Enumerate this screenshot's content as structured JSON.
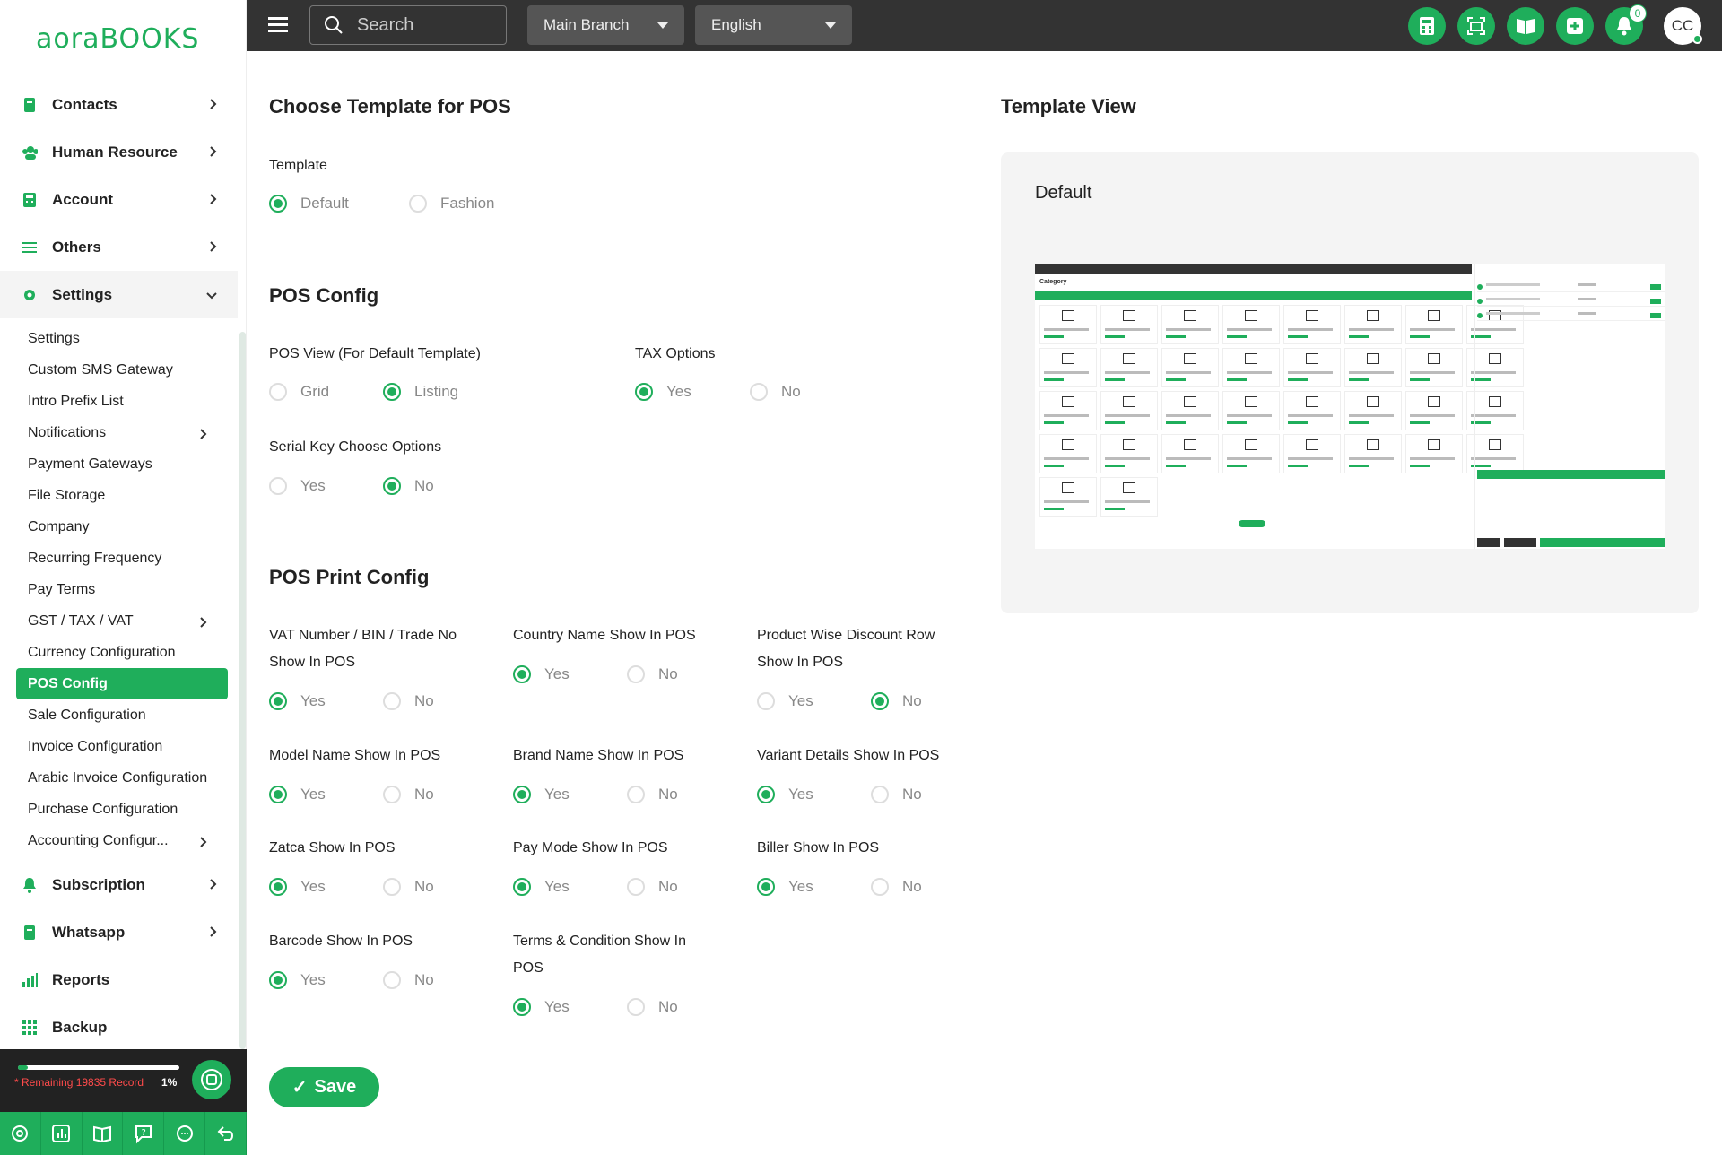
{
  "brand": {
    "logo_a": "aora",
    "logo_b": "BOOKS"
  },
  "sidebar": {
    "main": [
      {
        "label": "Contacts",
        "icon": "contacts-icon"
      },
      {
        "label": "Human Resource",
        "icon": "users-icon"
      },
      {
        "label": "Account",
        "icon": "calculator-icon"
      },
      {
        "label": "Others",
        "icon": "menu-icon"
      },
      {
        "label": "Settings",
        "icon": "gear-icon"
      }
    ],
    "sub": [
      {
        "label": "Settings"
      },
      {
        "label": "Custom SMS Gateway"
      },
      {
        "label": "Intro Prefix List"
      },
      {
        "label": "Notifications",
        "has_children": true
      },
      {
        "label": "Payment Gateways"
      },
      {
        "label": "File Storage"
      },
      {
        "label": "Company"
      },
      {
        "label": "Recurring Frequency"
      },
      {
        "label": "Pay Terms"
      },
      {
        "label": "GST / TAX / VAT",
        "has_children": true
      },
      {
        "label": "Currency Configuration"
      },
      {
        "label": "POS Config",
        "active": true
      },
      {
        "label": "Sale Configuration"
      },
      {
        "label": "Invoice Configuration"
      },
      {
        "label": "Arabic Invoice Configuration"
      },
      {
        "label": "Purchase Configuration"
      },
      {
        "label": "Accounting Configur...",
        "has_children": true
      }
    ],
    "bottom": [
      {
        "label": "Subscription",
        "icon": "bell-icon"
      },
      {
        "label": "Whatsapp",
        "icon": "whatsapp-icon"
      },
      {
        "label": "Reports",
        "icon": "bar-chart-icon"
      },
      {
        "label": "Backup",
        "icon": "grid-icon"
      }
    ],
    "footer": {
      "remaining": "* Remaining 19835 Record",
      "percent": "1%",
      "progress_fraction": 0.01
    }
  },
  "topbar": {
    "search_placeholder": "Search",
    "branch": "Main Branch",
    "language": "English",
    "notification_count": "0",
    "avatar": "CC"
  },
  "form": {
    "title": "Choose Template for POS",
    "template_label": "Template",
    "template_options": [
      "Default",
      "Fashion"
    ],
    "pos_config_title": "POS Config",
    "pos_view_label": "POS View (For Default Template)",
    "pos_view_options": [
      "Grid",
      "Listing"
    ],
    "tax_label": "TAX Options",
    "serial_label": "Serial Key Choose Options",
    "yes": "Yes",
    "no": "No",
    "print_title": "POS Print Config",
    "vat_label": "VAT Number / BIN / Trade No Show In POS",
    "country_label": "Country Name Show In POS",
    "discount_label": "Product Wise Discount Row Show In POS",
    "model_label": "Model Name Show In POS",
    "brand_label": "Brand Name Show In POS",
    "variant_label": "Variant Details Show In POS",
    "zatca_label": "Zatca Show In POS",
    "paymode_label": "Pay Mode Show In POS",
    "biller_label": "Biller Show In POS",
    "barcode_label": "Barcode Show In POS",
    "terms_label": "Terms & Condition Show In POS",
    "save": "Save"
  },
  "preview": {
    "title": "Template View",
    "card_title": "Default",
    "mini_category": "Category"
  },
  "colors": {
    "accent": "#1fae5b",
    "topbar": "#333333"
  }
}
